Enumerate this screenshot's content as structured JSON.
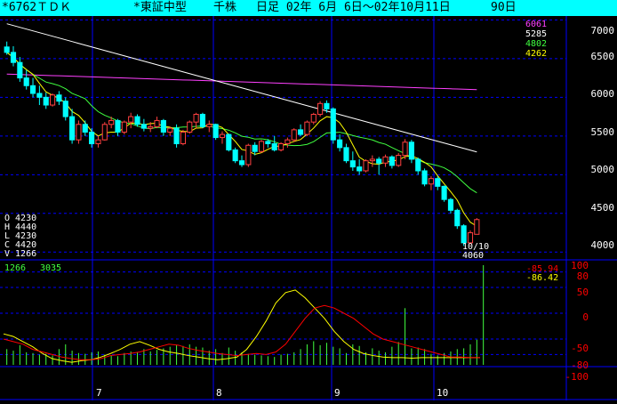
{
  "title": {
    "code_name": "*6762ＴＤＫ",
    "market": "*東証中型",
    "unit": "千株",
    "period": "日足 02年 6月 6日～02年10月11日",
    "count": "90日"
  },
  "price_axis_labels": [
    "7000",
    "6500",
    "6000",
    "5500",
    "5000",
    "4500",
    "4000"
  ],
  "ma_legend": [
    {
      "value": "6061",
      "color": "#ff40ff"
    },
    {
      "value": "5285",
      "color": "#ffffff"
    },
    {
      "value": "4802",
      "color": "#40ff40"
    },
    {
      "value": "4262",
      "color": "#ffff00"
    }
  ],
  "ohlcv": {
    "o": "O 4230",
    "h": "H 4440",
    "l": "L 4230",
    "c": "C 4420",
    "v": "V 1266"
  },
  "last_date": {
    "date": "10/10",
    "price": "4060"
  },
  "volume_legend": {
    "last": "1266",
    "max": "3035"
  },
  "osc_axis_labels": [
    "100",
    "80",
    "50",
    "0",
    "-50",
    "-80",
    "-100"
  ],
  "osc_values": [
    {
      "value": "-85.94",
      "color": "#ff0000"
    },
    {
      "value": "-86.42",
      "color": "#ffff00"
    }
  ],
  "month_labels": [
    "7",
    "8",
    "9",
    "10"
  ],
  "colors": {
    "up": "#ff4040",
    "down": "#00ffff",
    "grid": "#0000ff",
    "ma25": "#40ff40",
    "ma75": "#ffffff",
    "ma200": "#ff40ff",
    "ma_short": "#ffff00"
  },
  "chart_data": {
    "type": "candlestick",
    "title": "*6762ＴＤＫ 日足 02年 6月 6日～02年10月11日",
    "ylim": [
      3900,
      7050
    ],
    "candles": [
      [
        6650,
        6720,
        6550,
        6580
      ],
      [
        6580,
        6660,
        6400,
        6450
      ],
      [
        6450,
        6520,
        6200,
        6250
      ],
      [
        6250,
        6350,
        6100,
        6150
      ],
      [
        6150,
        6250,
        6000,
        6050
      ],
      [
        6050,
        6150,
        5900,
        6000
      ],
      [
        6000,
        6060,
        5850,
        5900
      ],
      [
        5900,
        6050,
        5880,
        6030
      ],
      [
        6030,
        6080,
        5900,
        5950
      ],
      [
        5950,
        6000,
        5700,
        5750
      ],
      [
        5750,
        5850,
        5400,
        5450
      ],
      [
        5450,
        5700,
        5400,
        5650
      ],
      [
        5650,
        5700,
        5500,
        5550
      ],
      [
        5550,
        5600,
        5350,
        5400
      ],
      [
        5400,
        5500,
        5350,
        5450
      ],
      [
        5450,
        5680,
        5440,
        5650
      ],
      [
        5650,
        5750,
        5600,
        5700
      ],
      [
        5700,
        5720,
        5500,
        5550
      ],
      [
        5550,
        5700,
        5520,
        5680
      ],
      [
        5680,
        5800,
        5600,
        5750
      ],
      [
        5750,
        5780,
        5620,
        5650
      ],
      [
        5650,
        5720,
        5560,
        5600
      ],
      [
        5600,
        5680,
        5550,
        5620
      ],
      [
        5620,
        5750,
        5600,
        5700
      ],
      [
        5700,
        5720,
        5500,
        5550
      ],
      [
        5550,
        5620,
        5500,
        5600
      ],
      [
        5600,
        5650,
        5350,
        5400
      ],
      [
        5400,
        5580,
        5380,
        5550
      ],
      [
        5550,
        5700,
        5530,
        5680
      ],
      [
        5680,
        5800,
        5600,
        5780
      ],
      [
        5780,
        5800,
        5600,
        5620
      ],
      [
        5620,
        5700,
        5550,
        5650
      ],
      [
        5650,
        5660,
        5450,
        5480
      ],
      [
        5480,
        5560,
        5400,
        5520
      ],
      [
        5520,
        5530,
        5300,
        5320
      ],
      [
        5320,
        5350,
        5150,
        5180
      ],
      [
        5180,
        5250,
        5100,
        5130
      ],
      [
        5130,
        5400,
        5100,
        5380
      ],
      [
        5380,
        5420,
        5250,
        5300
      ],
      [
        5300,
        5450,
        5280,
        5430
      ],
      [
        5430,
        5460,
        5350,
        5400
      ],
      [
        5400,
        5500,
        5300,
        5320
      ],
      [
        5320,
        5420,
        5300,
        5400
      ],
      [
        5400,
        5480,
        5350,
        5450
      ],
      [
        5450,
        5600,
        5420,
        5580
      ],
      [
        5580,
        5650,
        5500,
        5520
      ],
      [
        5520,
        5700,
        5500,
        5680
      ],
      [
        5680,
        5800,
        5650,
        5780
      ],
      [
        5780,
        5950,
        5750,
        5920
      ],
      [
        5920,
        5960,
        5800,
        5850
      ],
      [
        5850,
        5870,
        5400,
        5450
      ],
      [
        5450,
        5520,
        5300,
        5350
      ],
      [
        5350,
        5400,
        5150,
        5180
      ],
      [
        5180,
        5300,
        5050,
        5100
      ],
      [
        5100,
        5200,
        5000,
        5050
      ],
      [
        5050,
        5200,
        5030,
        5180
      ],
      [
        5180,
        5250,
        5100,
        5200
      ],
      [
        5200,
        5230,
        5000,
        5150
      ],
      [
        5150,
        5260,
        5100,
        5230
      ],
      [
        5230,
        5250,
        5080,
        5120
      ],
      [
        5120,
        5280,
        5100,
        5250
      ],
      [
        5250,
        5460,
        5200,
        5420
      ],
      [
        5420,
        5450,
        5150,
        5200
      ],
      [
        5200,
        5220,
        5000,
        5050
      ],
      [
        5050,
        5080,
        4850,
        4880
      ],
      [
        4880,
        4980,
        4800,
        4950
      ],
      [
        4950,
        4980,
        4800,
        4850
      ],
      [
        4850,
        4860,
        4650,
        4680
      ],
      [
        4680,
        4700,
        4500,
        4540
      ],
      [
        4540,
        4560,
        4300,
        4340
      ],
      [
        4340,
        4360,
        4080,
        4120
      ],
      [
        4120,
        4280,
        4100,
        4250
      ],
      [
        4230,
        4440,
        4230,
        4420
      ]
    ],
    "volume": [
      200,
      180,
      250,
      160,
      150,
      130,
      140,
      120,
      200,
      260,
      180,
      150,
      140,
      160,
      170,
      130,
      120,
      110,
      150,
      170,
      160,
      200,
      170,
      190,
      210,
      230,
      250,
      240,
      260,
      230,
      220,
      180,
      200,
      150,
      220,
      180,
      160,
      140,
      130,
      120,
      110,
      100,
      130,
      140,
      160,
      200,
      260,
      300,
      250,
      280,
      230,
      210,
      150,
      260,
      240,
      160,
      210,
      180,
      160,
      230,
      290,
      720,
      210,
      220,
      200,
      140,
      120,
      150,
      170,
      200,
      210,
      260,
      320,
      1266
    ],
    "osc_red": [
      -50,
      -55,
      -60,
      -70,
      -75,
      -80,
      -85,
      -88,
      -90,
      -90,
      -88,
      -82,
      -80,
      -78,
      -75,
      -70,
      -65,
      -60,
      -62,
      -68,
      -72,
      -75,
      -78,
      -80,
      -82,
      -80,
      -78,
      -80,
      -75,
      -60,
      -35,
      -10,
      10,
      15,
      10,
      0,
      -10,
      -25,
      -40,
      -50,
      -55,
      -60,
      -65,
      -70,
      -75,
      -80,
      -85,
      -85,
      -86,
      -86
    ],
    "osc_yellow": [
      -40,
      -45,
      -55,
      -65,
      -78,
      -88,
      -92,
      -95,
      -92,
      -90,
      -85,
      -78,
      -70,
      -60,
      -55,
      -62,
      -70,
      -75,
      -78,
      -82,
      -85,
      -88,
      -90,
      -88,
      -85,
      -70,
      -45,
      -15,
      20,
      40,
      45,
      30,
      10,
      -10,
      -35,
      -55,
      -70,
      -78,
      -82,
      -85,
      -86,
      -86,
      -87,
      -86,
      -86,
      -86,
      -86,
      -86,
      -86,
      -86
    ]
  }
}
